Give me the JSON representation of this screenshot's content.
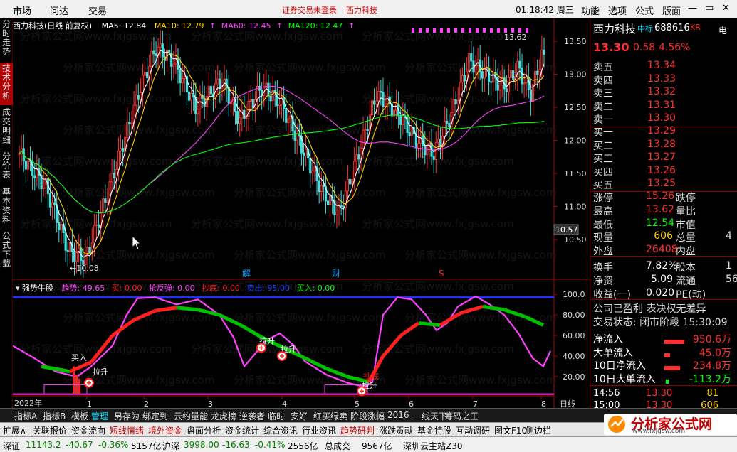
{
  "menu": {
    "items": [
      "市场",
      "问达",
      "交易"
    ],
    "warning": "证券交易未登录",
    "warning_stock": "西力科技",
    "clock": "01:18:42 周三",
    "right_items": [
      "功能",
      "选项",
      "公式",
      "版面"
    ]
  },
  "sidebar": {
    "tabs": [
      "分时走势",
      "技术分析",
      "成交明细",
      "分价表",
      "基本资料",
      "公式下载"
    ],
    "active": 1
  },
  "main_chart": {
    "title": "西力科技(日线 前复权)",
    "ma": [
      {
        "label": "MA5: 12.84",
        "color": "#ffffff"
      },
      {
        "label": "MA10: 12.79",
        "color": "#ffd000"
      },
      {
        "label": "MA60: 12.45",
        "color": "#ff40ff"
      },
      {
        "label": "MA120: 12.47",
        "color": "#00ff00"
      }
    ],
    "price_labels": [
      "13.50",
      "13.00",
      "12.50",
      "12.00",
      "11.50",
      "11.00",
      "10.50"
    ],
    "current_price_tag": "10.57",
    "high_mark": "13.62",
    "low_mark": "10.08",
    "event_marks": [
      {
        "text": "解",
        "color": "#00a0ff"
      },
      {
        "text": "财",
        "color": "#00a0ff"
      },
      {
        "text": "S",
        "color": "#ff2020"
      }
    ]
  },
  "sub_chart": {
    "name": "强势牛股",
    "params": [
      {
        "label": "趋势: 49.65",
        "color": "#ff40ff"
      },
      {
        "label": "买: 0.00",
        "color": "#ff2020"
      },
      {
        "label": "抢反弹: 0.00",
        "color": "#ff40ff"
      },
      {
        "label": "抄底: 0.00",
        "color": "#ff2020"
      },
      {
        "label": "卖出: 95.00",
        "color": "#2040ff"
      },
      {
        "label": "买入: 0.00",
        "color": "#00ff00"
      }
    ],
    "scale": [
      "100.0",
      "80.00",
      "60.00",
      "40.00",
      "20.00"
    ],
    "annotations": [
      "买入",
      "拉升",
      "拉升",
      "拉升",
      "抄底",
      "拉升"
    ]
  },
  "xaxis": {
    "year": "2022年",
    "months": [
      "1",
      "2",
      "3",
      "4",
      "5",
      "6",
      "7",
      "8"
    ],
    "period": "日线"
  },
  "quote": {
    "name": "西力科技",
    "tag": "中标",
    "code": "688616",
    "market": "KR",
    "extra": "电",
    "price": "13.30",
    "change": "0.58",
    "pct": "4.56%",
    "asks": [
      {
        "label": "卖五",
        "price": "13.34"
      },
      {
        "label": "卖四",
        "price": "13.33"
      },
      {
        "label": "卖三",
        "price": "13.32"
      },
      {
        "label": "卖二",
        "price": "13.31"
      },
      {
        "label": "卖一",
        "price": "13.30"
      }
    ],
    "bids": [
      {
        "label": "买一",
        "price": "13.29"
      },
      {
        "label": "买二",
        "price": "13.28"
      },
      {
        "label": "买三",
        "price": "13.27"
      },
      {
        "label": "买四",
        "price": "13.26"
      },
      {
        "label": "买五",
        "price": "13.25"
      }
    ],
    "stats": [
      {
        "k1": "涨停",
        "v1": "15.26",
        "k2": "跌停",
        "c1": "#ff3030"
      },
      {
        "k1": "最高",
        "v1": "13.62",
        "k2": "量比",
        "c1": "#ff3030"
      },
      {
        "k1": "最低",
        "v1": "12.54",
        "k2": "市值",
        "c1": "#00ff00"
      },
      {
        "k1": "现量",
        "v1": "606",
        "k2": "总量",
        "v2": "4",
        "c1": "#ffd000"
      },
      {
        "k1": "外盘",
        "v1": "26408",
        "k2": "内盘",
        "c1": "#ff3030"
      },
      {
        "k1": "换手",
        "v1": "7.82%",
        "k2": "股本",
        "v2": "1",
        "c1": "#ffffff"
      },
      {
        "k1": "净资",
        "v1": "5.09",
        "k2": "流通",
        "v2": "56",
        "c1": "#ffffff"
      },
      {
        "k1": "收益(一)",
        "v1": "0.020",
        "k2": "PE(动)",
        "c1": "#ffffff"
      }
    ],
    "note1": "公司已盈利 表决权无差异",
    "note2": "交易状态: 闭市阶段 15:30:09",
    "flows": [
      {
        "label": "净流入",
        "value": "950.6万",
        "c": "#ff3030"
      },
      {
        "label": "大单流入",
        "value": "45.0万",
        "c": "#ff3030"
      },
      {
        "label": "10日净流入",
        "value": "234.8万",
        "c": "#ff3030"
      },
      {
        "label": "10日大单流入",
        "value": "-113.2万",
        "c": "#00ff00"
      }
    ],
    "ticks": [
      {
        "time": "14:56",
        "price": "13.30",
        "vol": "81"
      },
      {
        "time": "15:00",
        "price": "13.30",
        "vol": "606"
      }
    ]
  },
  "bottom_tabs": [
    "指标A",
    "指标B",
    "模板",
    "管理",
    "另存为",
    "绑定到",
    "云约量能",
    "龙虎榜",
    "逆袭者",
    "临时",
    "安好",
    "红买绿卖",
    "阶段涨幅",
    "2016",
    "一线天下",
    "筹码之王"
  ],
  "bottom_active": 3,
  "toolbar": [
    "扩展∧",
    "关联报价",
    "资金流向",
    "短线情绪",
    "境外资金",
    "盘面分析",
    "资金统计",
    "综合资讯",
    "行业资讯",
    "趋势研判",
    "涨跌贡献",
    "基金持股",
    "互动调研",
    "图文F10",
    "侧边栏"
  ],
  "status": {
    "idx1": "深证",
    "v1": "11143.2",
    "c1": "-40.67",
    "p1": "-0.36%",
    "a1": "5157亿",
    "idx2": "沪深",
    "v2": "3998.00",
    "c2": "-16.63",
    "p2": "-0.41%",
    "a2": "2556亿",
    "t1": "总成交",
    "t2": "9567亿",
    "t3": "深圳云主站Z30"
  },
  "logo": {
    "name": "分析家公式网",
    "url": "www.fxjgsw.com"
  },
  "watermark": "分析家公式网www.fxjgsw.com"
}
